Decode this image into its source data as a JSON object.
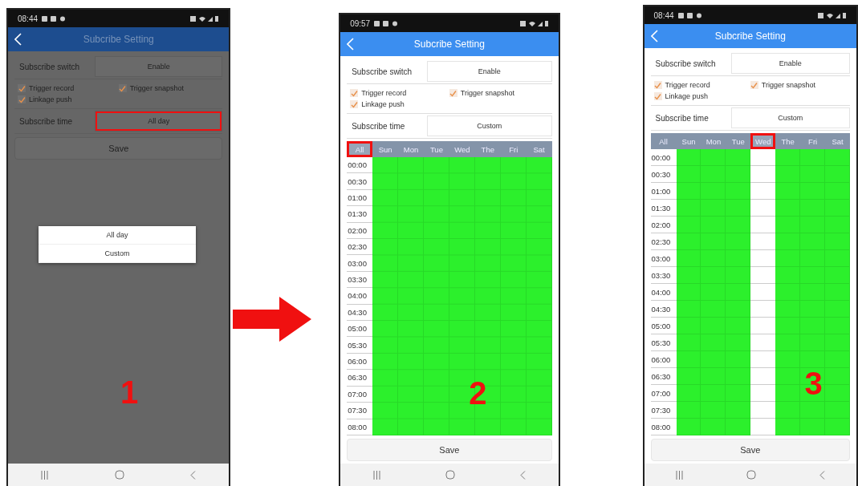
{
  "panels": [
    {
      "status_time": "08:44",
      "dimmed": true,
      "title": "Subcribe Setting",
      "switch": {
        "label": "Subscribe switch",
        "value": "Enable",
        "highlighted": false
      },
      "checks": [
        {
          "label": "Trigger record",
          "checked": true
        },
        {
          "label": "Trigger snapshot",
          "checked": true
        },
        {
          "label": "Linkage push",
          "checked": true
        }
      ],
      "time": {
        "label": "Subscribe time",
        "value": "All day",
        "highlighted": true
      },
      "save": "Save",
      "popup": [
        "All day",
        "Custom"
      ],
      "step": "1"
    },
    {
      "status_time": "09:57",
      "dimmed": false,
      "title": "Subcribe Setting",
      "switch": {
        "label": "Subscribe switch",
        "value": "Enable",
        "highlighted": false
      },
      "checks": [
        {
          "label": "Trigger record",
          "checked": true
        },
        {
          "label": "Trigger snapshot",
          "checked": true
        },
        {
          "label": "Linkage push",
          "checked": true
        }
      ],
      "time": {
        "label": "Subscribe time",
        "value": "Custom",
        "highlighted": false
      },
      "schedule": {
        "all": {
          "label": "All",
          "highlighted": true
        },
        "days": [
          {
            "label": "Sun",
            "on": true,
            "highlighted": false
          },
          {
            "label": "Mon",
            "on": true,
            "highlighted": false
          },
          {
            "label": "Tue",
            "on": true,
            "highlighted": false
          },
          {
            "label": "Wed",
            "on": true,
            "highlighted": false
          },
          {
            "label": "The",
            "on": true,
            "highlighted": false
          },
          {
            "label": "Fri",
            "on": true,
            "highlighted": false
          },
          {
            "label": "Sat",
            "on": true,
            "highlighted": false
          }
        ],
        "times": [
          "00:00",
          "00:30",
          "01:00",
          "01:30",
          "02:00",
          "02:30",
          "03:00",
          "03:30",
          "04:00",
          "04:30",
          "05:00",
          "05:30",
          "06:00",
          "06:30",
          "07:00",
          "07:30",
          "08:00"
        ]
      },
      "save": "Save",
      "step": "2"
    },
    {
      "status_time": "08:44",
      "dimmed": false,
      "title": "Subcribe Setting",
      "switch": {
        "label": "Subscribe switch",
        "value": "Enable",
        "highlighted": false
      },
      "checks": [
        {
          "label": "Trigger record",
          "checked": true
        },
        {
          "label": "Trigger snapshot",
          "checked": true
        },
        {
          "label": "Linkage push",
          "checked": true
        }
      ],
      "time": {
        "label": "Subscribe time",
        "value": "Custom",
        "highlighted": false
      },
      "schedule": {
        "all": {
          "label": "All",
          "highlighted": false
        },
        "days": [
          {
            "label": "Sun",
            "on": true,
            "highlighted": false
          },
          {
            "label": "Mon",
            "on": true,
            "highlighted": false
          },
          {
            "label": "Tue",
            "on": true,
            "highlighted": false
          },
          {
            "label": "Wed",
            "on": false,
            "highlighted": true
          },
          {
            "label": "The",
            "on": true,
            "highlighted": false
          },
          {
            "label": "Fri",
            "on": true,
            "highlighted": false
          },
          {
            "label": "Sat",
            "on": true,
            "highlighted": false
          }
        ],
        "times": [
          "00:00",
          "00:30",
          "01:00",
          "01:30",
          "02:00",
          "02:30",
          "03:00",
          "03:30",
          "04:00",
          "04:30",
          "05:00",
          "05:30",
          "06:00",
          "06:30",
          "07:00",
          "07:30",
          "08:00"
        ]
      },
      "save": "Save",
      "step": "3"
    }
  ]
}
